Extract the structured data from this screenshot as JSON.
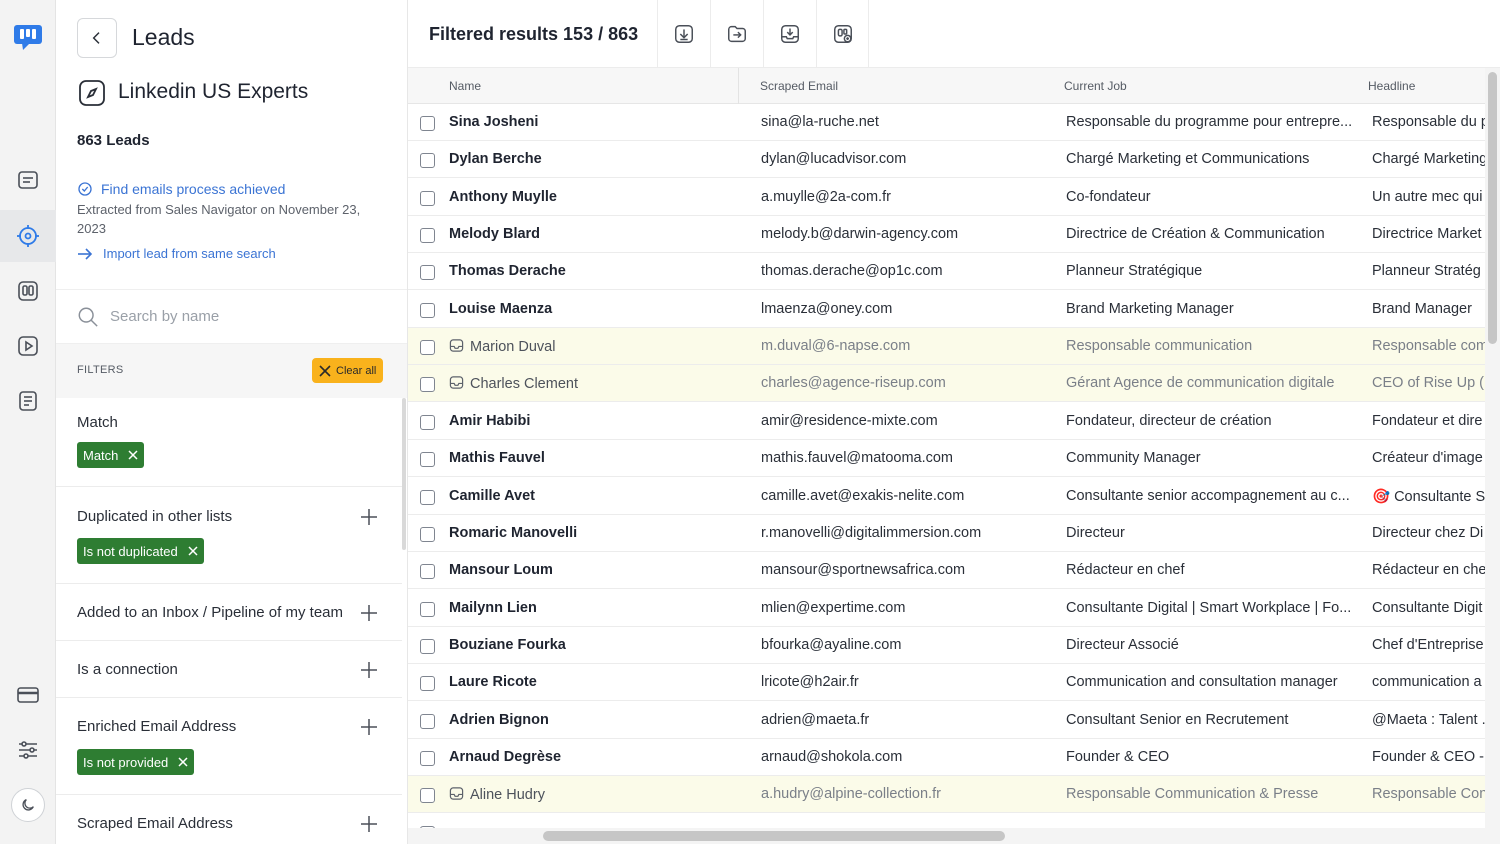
{
  "header": {
    "title": "Leads",
    "list_name": "Linkedin US Experts",
    "lead_count": "863 Leads"
  },
  "process": {
    "status": "Find emails process achieved",
    "extracted": "Extracted from Sales Navigator on November 23, 2023",
    "import_link": "Import lead from same search"
  },
  "search": {
    "placeholder": "Search by name"
  },
  "filters": {
    "label": "FILTERS",
    "clear_all": "Clear all",
    "items": [
      {
        "label": "Match",
        "chip": "Match"
      },
      {
        "label": "Duplicated in other lists",
        "chip": "Is not duplicated"
      },
      {
        "label": "Added to an Inbox / Pipeline of my team",
        "chip": ""
      },
      {
        "label": "Is a connection",
        "chip": ""
      },
      {
        "label": "Enriched Email Address",
        "chip": "Is not provided"
      },
      {
        "label": "Scraped Email Address",
        "chip": ""
      }
    ]
  },
  "results": {
    "title": "Filtered results 153 / 863"
  },
  "table": {
    "columns": [
      "Name",
      "Scraped Email",
      "Current Job",
      "Headline"
    ],
    "rows": [
      {
        "name": "Sina Josheni",
        "email": "sina@la-ruche.net",
        "job": "Responsable du programme pour entrepre...",
        "headline": "Responsable du p",
        "inbox": false
      },
      {
        "name": "Dylan Berche",
        "email": "dylan@lucadvisor.com",
        "job": "Chargé Marketing et Communications",
        "headline": "Chargé Marketing",
        "inbox": false
      },
      {
        "name": "Anthony Muylle",
        "email": "a.muylle@2a-com.fr",
        "job": "Co-fondateur",
        "headline": "Un autre mec qui",
        "inbox": false
      },
      {
        "name": "Melody Blard",
        "email": "melody.b@darwin-agency.com",
        "job": "Directrice de Création & Communication",
        "headline": "Directrice Market",
        "inbox": false
      },
      {
        "name": "Thomas Derache",
        "email": "thomas.derache@op1c.com",
        "job": "Planneur Stratégique",
        "headline": "Planneur Stratég",
        "inbox": false
      },
      {
        "name": "Louise Maenza",
        "email": "lmaenza@oney.com",
        "job": "Brand Marketing Manager",
        "headline": "Brand Manager",
        "inbox": false
      },
      {
        "name": "Marion Duval",
        "email": "m.duval@6-napse.com",
        "job": "Responsable communication",
        "headline": "Responsable com",
        "inbox": true
      },
      {
        "name": "Charles Clement",
        "email": "charles@agence-riseup.com",
        "job": "Gérant Agence de communication digitale",
        "headline": "CEO of Rise Up (D",
        "inbox": true
      },
      {
        "name": "Amir Habibi",
        "email": "amir@residence-mixte.com",
        "job": "Fondateur, directeur de création",
        "headline": "Fondateur et dire",
        "inbox": false
      },
      {
        "name": "Mathis Fauvel",
        "email": "mathis.fauvel@matooma.com",
        "job": "Community Manager",
        "headline": "Créateur d'image",
        "inbox": false
      },
      {
        "name": "Camille Avet",
        "email": "camille.avet@exakis-nelite.com",
        "job": "Consultante senior accompagnement au c...",
        "headline": "🎯 Consultante Se",
        "inbox": false
      },
      {
        "name": "Romaric Manovelli",
        "email": "r.manovelli@digitalimmersion.com",
        "job": "Directeur",
        "headline": "Directeur chez Di",
        "inbox": false
      },
      {
        "name": "Mansour Loum",
        "email": "mansour@sportnewsafrica.com",
        "job": "Rédacteur en chef",
        "headline": "Rédacteur en che",
        "inbox": false
      },
      {
        "name": "Mailynn Lien",
        "email": "mlien@expertime.com",
        "job": "Consultante Digital | Smart Workplace | Fo...",
        "headline": "Consultante Digit",
        "inbox": false
      },
      {
        "name": "Bouziane Fourka",
        "email": "bfourka@ayaline.com",
        "job": "Directeur Associé",
        "headline": "Chef d'Entreprise",
        "inbox": false
      },
      {
        "name": "Laure Ricote",
        "email": "lricote@h2air.fr",
        "job": "Communication and consultation manager",
        "headline": "communication a",
        "inbox": false
      },
      {
        "name": "Adrien Bignon",
        "email": "adrien@maeta.fr",
        "job": "Consultant Senior en Recrutement",
        "headline": "@Maeta : Talent .",
        "inbox": false
      },
      {
        "name": "Arnaud Degrèse",
        "email": "arnaud@shokola.com",
        "job": "Founder & CEO",
        "headline": "Founder & CEO -",
        "inbox": false
      },
      {
        "name": "Aline Hudry",
        "email": "a.hudry@alpine-collection.fr",
        "job": "Responsable Communication & Presse",
        "headline": "Responsable Con",
        "inbox": true
      },
      {
        "name": "",
        "email": "",
        "job": "",
        "headline": "",
        "inbox": false
      }
    ]
  },
  "colors": {
    "accent": "#3b74d4",
    "chip_green": "#2e7d32",
    "clear_all": "#f9b21c",
    "highlight_row": "#fbfbe9",
    "logo": "#2f7be8"
  },
  "icons": [
    "app-logo-icon",
    "messages-icon",
    "target-icon",
    "board-icon",
    "play-icon",
    "notes-icon",
    "card-icon",
    "sliders-icon",
    "moon-icon",
    "download-icon",
    "export-icon",
    "import-icon",
    "enrich-icon",
    "inbox-icon"
  ]
}
